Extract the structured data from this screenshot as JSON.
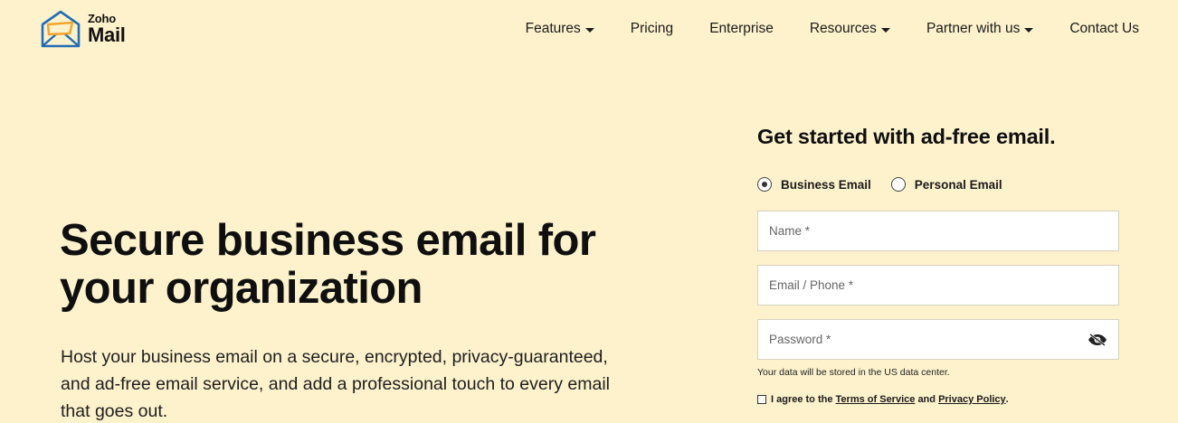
{
  "brand": {
    "line1": "Zoho",
    "line2": "Mail",
    "accent_blue": "#226db4",
    "accent_yellow": "#f4a42e"
  },
  "nav": {
    "items": [
      {
        "label": "Features",
        "has_dropdown": true
      },
      {
        "label": "Pricing",
        "has_dropdown": false
      },
      {
        "label": "Enterprise",
        "has_dropdown": false
      },
      {
        "label": "Resources",
        "has_dropdown": true
      },
      {
        "label": "Partner with us",
        "has_dropdown": true
      },
      {
        "label": "Contact Us",
        "has_dropdown": false
      }
    ]
  },
  "hero": {
    "title": "Secure business email for your organization",
    "description": "Host your business email on a secure, encrypted, privacy-guaranteed, and ad-free email service, and add a professional touch to every email that goes out."
  },
  "signup": {
    "title": "Get started with ad-free email.",
    "account_types": [
      {
        "label": "Business Email",
        "selected": true
      },
      {
        "label": "Personal Email",
        "selected": false
      }
    ],
    "fields": {
      "name": {
        "placeholder": "Name *",
        "value": ""
      },
      "email_phone": {
        "placeholder": "Email / Phone *",
        "value": ""
      },
      "password": {
        "placeholder": "Password *",
        "value": ""
      }
    },
    "data_center_note": "Your data will be stored in the US data center.",
    "agreement": {
      "prefix": "I agree to the",
      "terms_link": "Terms of Service",
      "connector": "and",
      "privacy_link": "Privacy Policy",
      "suffix": ".",
      "checked": false
    }
  },
  "icons": {
    "logo": "zoho-mail-envelope-icon",
    "password_toggle": "eye-slash-icon",
    "dropdown": "caret-down-icon"
  },
  "colors": {
    "background": "#fdf2cc",
    "text": "#111111"
  }
}
